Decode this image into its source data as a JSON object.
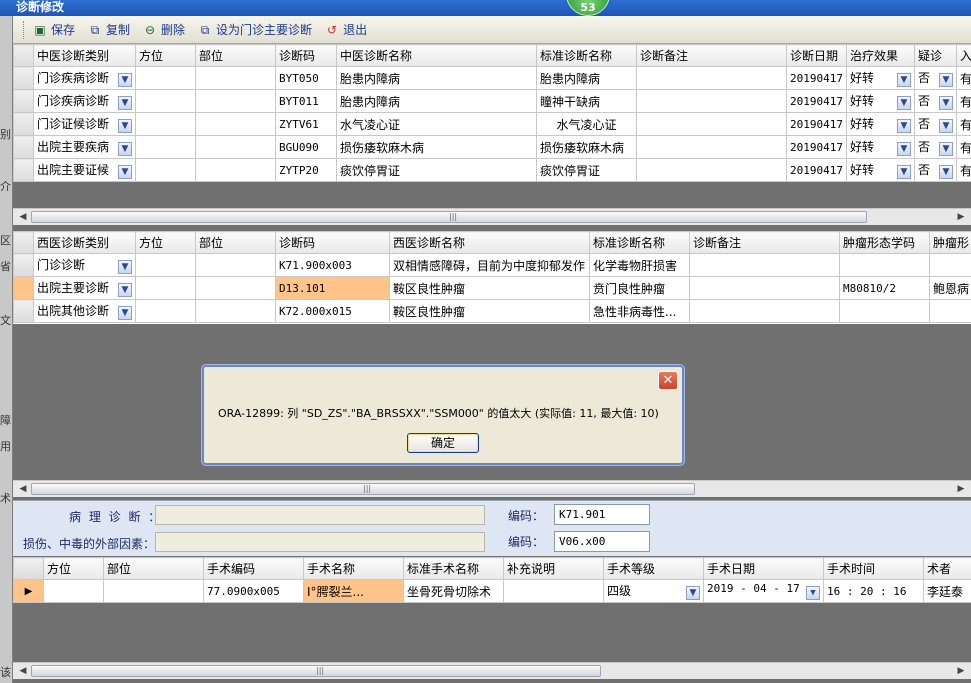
{
  "window": {
    "title": "诊断修改",
    "badge": "53"
  },
  "left_strip": [
    "别",
    "介",
    "区",
    "省",
    "文",
    "障",
    "用",
    "术",
    "该"
  ],
  "toolbar": {
    "save": "保存",
    "copy": "复制",
    "delete": "删除",
    "set_main": "设为门诊主要诊断",
    "exit": "退出"
  },
  "tcm_grid": {
    "headers": [
      "中医诊断类别",
      "方位",
      "部位",
      "诊断码",
      "中医诊断名称",
      "标准诊断名称",
      "诊断备注",
      "诊断日期",
      "治疗效果",
      "疑诊",
      "入"
    ],
    "rows": [
      {
        "cat": "门诊疾病诊断",
        "fw": "",
        "bw": "",
        "code": "BYT050",
        "name": "胎患内障病",
        "std": "胎患内障病",
        "note": "",
        "date": "20190417",
        "eff": "好转",
        "yz": "否",
        "r": "有"
      },
      {
        "cat": "门诊疾病诊断",
        "fw": "",
        "bw": "",
        "code": "BYT011",
        "name": "胎患内障病",
        "std": "瞳神干缺病",
        "note": "",
        "date": "20190417",
        "eff": "好转",
        "yz": "否",
        "r": "有"
      },
      {
        "cat": "门诊证候诊断",
        "fw": "",
        "bw": "",
        "code": "ZYTV61",
        "name": "水气凌心证",
        "std": "水气凌心证",
        "note": "",
        "date": "20190417",
        "eff": "好转",
        "yz": "否",
        "r": "有"
      },
      {
        "cat": "出院主要疾病",
        "fw": "",
        "bw": "",
        "code": "BGU090",
        "name": "损伤痿软麻木病",
        "std": "损伤痿软麻木病",
        "note": "",
        "date": "20190417",
        "eff": "好转",
        "yz": "否",
        "r": "有"
      },
      {
        "cat": "出院主要证候",
        "fw": "",
        "bw": "",
        "code": "ZYTP20",
        "name": "痰饮停胃证",
        "std": "痰饮停胃证",
        "note": "",
        "date": "20190417",
        "eff": "好转",
        "yz": "否",
        "r": "有"
      }
    ]
  },
  "wm_grid": {
    "headers": [
      "西医诊断类别",
      "方位",
      "部位",
      "诊断码",
      "西医诊断名称",
      "标准诊断名称",
      "诊断备注",
      "肿瘤形态学码",
      "肿瘤形"
    ],
    "rows": [
      {
        "cat": "门诊诊断",
        "fw": "",
        "bw": "",
        "code": "K71.900x003",
        "name": "双相情感障碍，目前为中度抑郁发作",
        "std": "化学毒物肝损害",
        "note": "",
        "morph": "",
        "m2": ""
      },
      {
        "cat": "出院主要诊断",
        "fw": "",
        "bw": "",
        "code": "D13.101",
        "name": "鞍区良性肿瘤",
        "std": "贲门良性肿瘤",
        "note": "",
        "morph": "M80810/2",
        "m2": "鲍恩病"
      },
      {
        "cat": "出院其他诊断",
        "fw": "",
        "bw": "",
        "code": "K72.000x015",
        "name": "鞍区良性肿瘤",
        "std": "急性非病毒性...",
        "note": "",
        "morph": "",
        "m2": ""
      }
    ]
  },
  "dialog": {
    "message": "ORA-12899: 列 \"SD_ZS\".\"BA_BRSSXX\".\"SSM000\" 的值太大 (实际值: 11, 最大值: 10)",
    "ok": "确定",
    "close": "✕"
  },
  "info": {
    "pathology_label": "病 理 诊 断 ：",
    "injury_label": "损伤、中毒的外部因素：",
    "code_label1": "编码：",
    "code_value1": "K71.901",
    "code_label2": "编码：",
    "code_value2": "V06.x00"
  },
  "surgery_grid": {
    "headers": [
      "方位",
      "部位",
      "手术编码",
      "手术名称",
      "标准手术名称",
      "补充说明",
      "手术等级",
      "手术日期",
      "手术时间",
      "术者"
    ],
    "rows": [
      {
        "fw": "",
        "bw": "",
        "code": "77.0900x005",
        "name": "Ⅰ°腭裂兰...",
        "std": "坐骨死骨切除术",
        "note": "",
        "level": "四级",
        "date": "2019 - 04 - 17",
        "time": "16 : 20 : 16",
        "surgeon": "李廷泰"
      }
    ]
  }
}
